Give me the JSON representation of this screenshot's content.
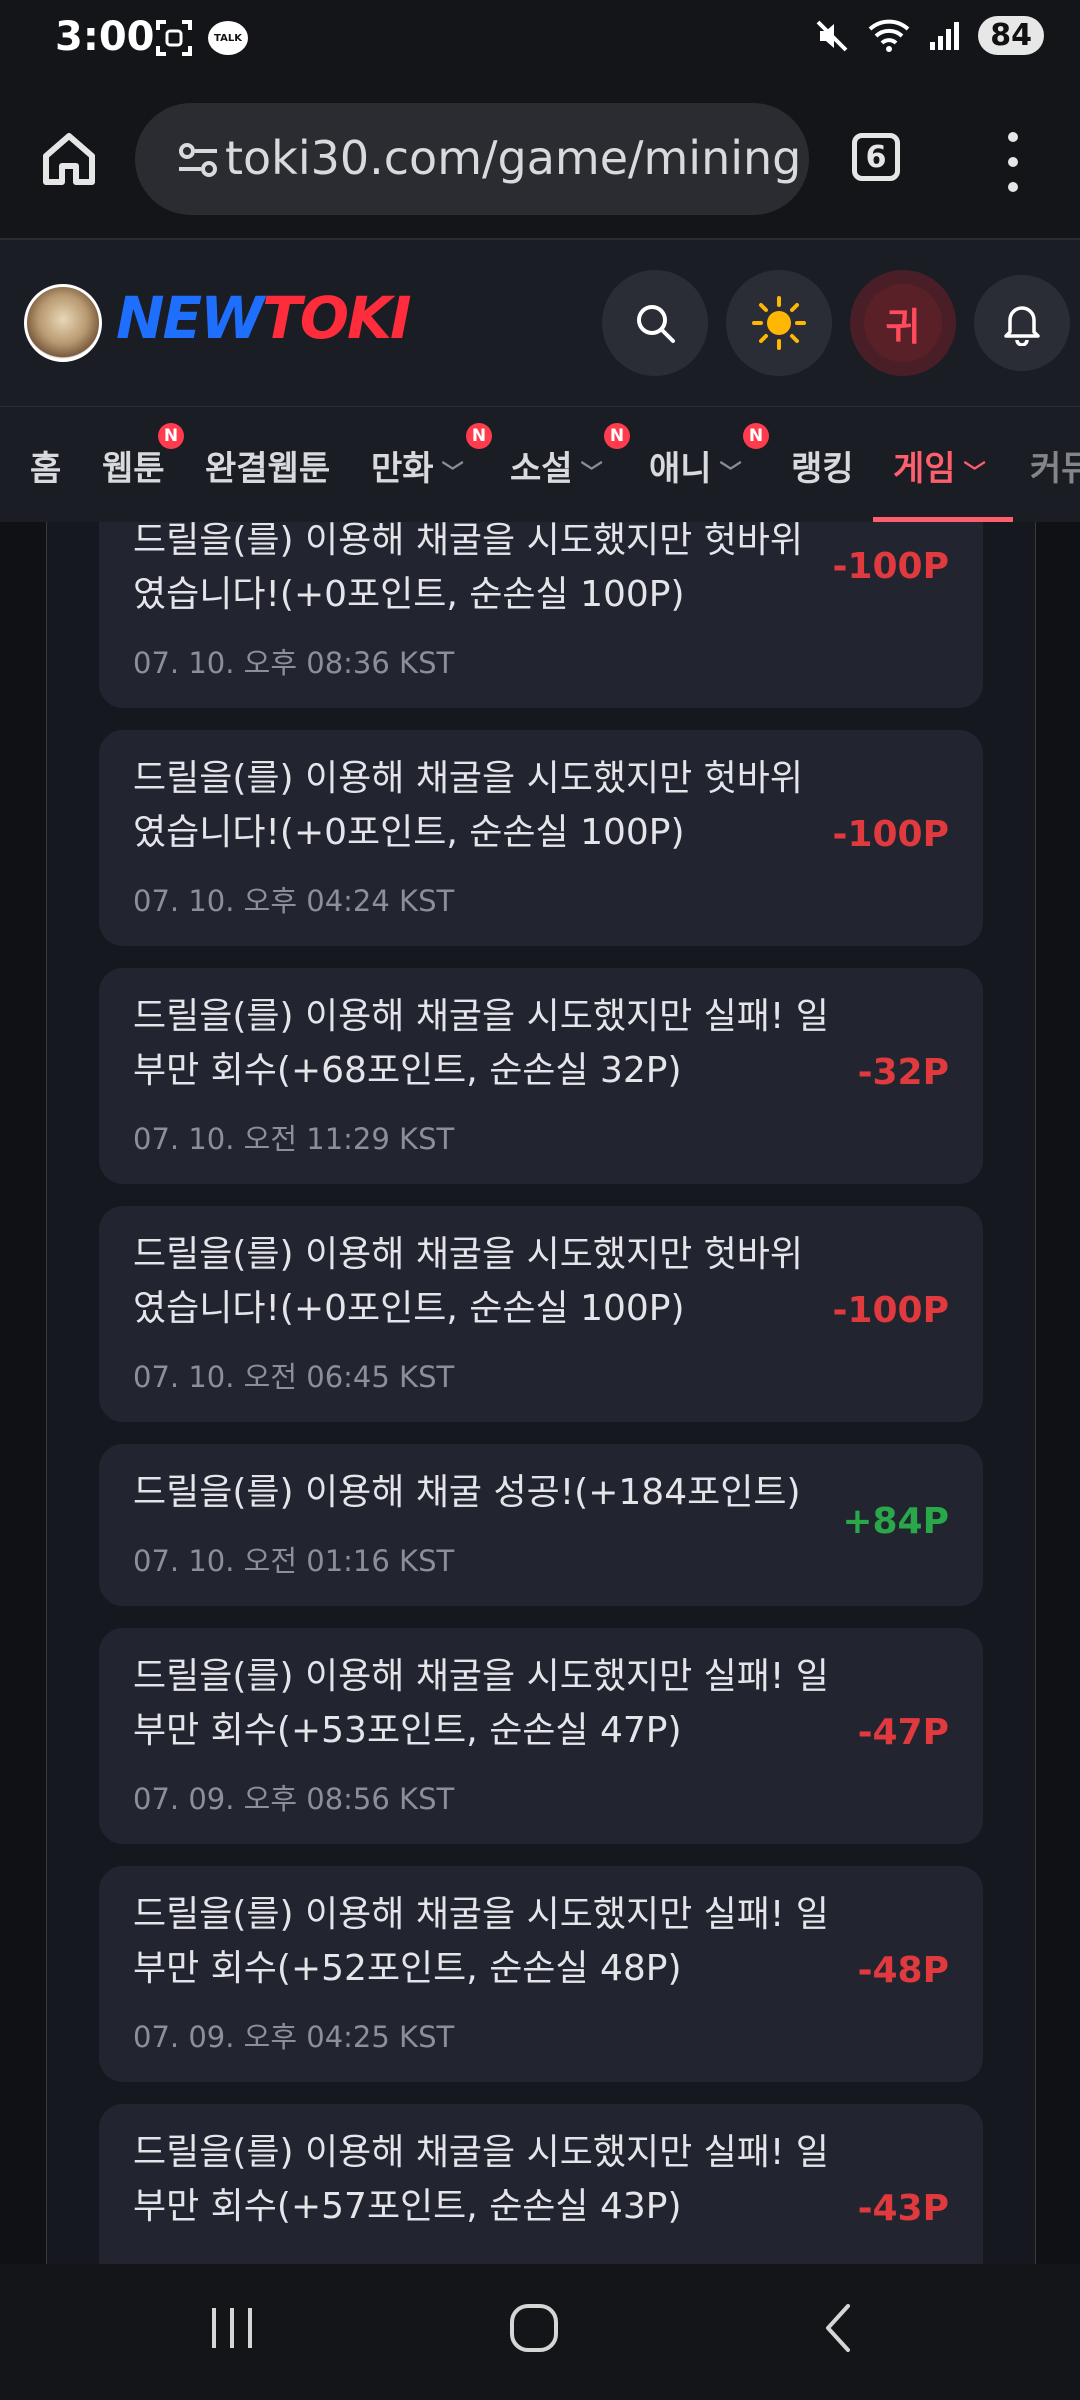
{
  "status_bar": {
    "time": "3:00",
    "battery": "84",
    "notif_talk": "TALK"
  },
  "browser": {
    "url": "toki30.com/game/mining",
    "tab_count": "6"
  },
  "site": {
    "logo_new": "NEW",
    "logo_toki": "TOKI",
    "user_initial": "귀"
  },
  "nav": {
    "items": [
      {
        "label": "홈"
      },
      {
        "label": "웹툰",
        "badge": "N"
      },
      {
        "label": "완결웹툰"
      },
      {
        "label": "만화",
        "badge": "N"
      },
      {
        "label": "소설",
        "badge": "N"
      },
      {
        "label": "애니",
        "badge": "N"
      },
      {
        "label": "랭킹"
      },
      {
        "label": "게임"
      },
      {
        "label": "커뮤"
      }
    ]
  },
  "records": [
    {
      "message": "드릴을(를) 이용해 채굴을 시도했지만 헛바위였습니다!(+0포인트, 순손실 100P)",
      "time": "07. 10. 오후 08:36 KST",
      "amount": "-100P"
    },
    {
      "message": "드릴을(를) 이용해 채굴을 시도했지만 헛바위였습니다!(+0포인트, 순손실 100P)",
      "time": "07. 10. 오후 04:24 KST",
      "amount": "-100P"
    },
    {
      "message": "드릴을(를) 이용해 채굴을 시도했지만 실패! 일부만 회수(+68포인트, 순손실 32P)",
      "time": "07. 10. 오전 11:29 KST",
      "amount": "-32P"
    },
    {
      "message": "드릴을(를) 이용해 채굴을 시도했지만 헛바위였습니다!(+0포인트, 순손실 100P)",
      "time": "07. 10. 오전 06:45 KST",
      "amount": "-100P"
    },
    {
      "message": "드릴을(를) 이용해 채굴 성공!(+184포인트)",
      "time": "07. 10. 오전 01:16 KST",
      "amount": "+84P"
    },
    {
      "message": "드릴을(를) 이용해 채굴을 시도했지만 실패! 일부만 회수(+53포인트, 순손실 47P)",
      "time": "07. 09. 오후 08:56 KST",
      "amount": "-47P"
    },
    {
      "message": "드릴을(를) 이용해 채굴을 시도했지만 실패! 일부만 회수(+52포인트, 순손실 48P)",
      "time": "07. 09. 오후 04:25 KST",
      "amount": "-48P"
    },
    {
      "message": "드릴을(를) 이용해 채굴을 시도했지만 실패! 일부만 회수(+57포인트, 순손실 43P)",
      "time": "",
      "amount": "-43P"
    }
  ],
  "colors": {
    "loss": "#e0393e",
    "gain": "#29a84a",
    "accent": "#ff5f6d",
    "logo_blue": "#1f6fff",
    "logo_red": "#ff2d3c"
  }
}
